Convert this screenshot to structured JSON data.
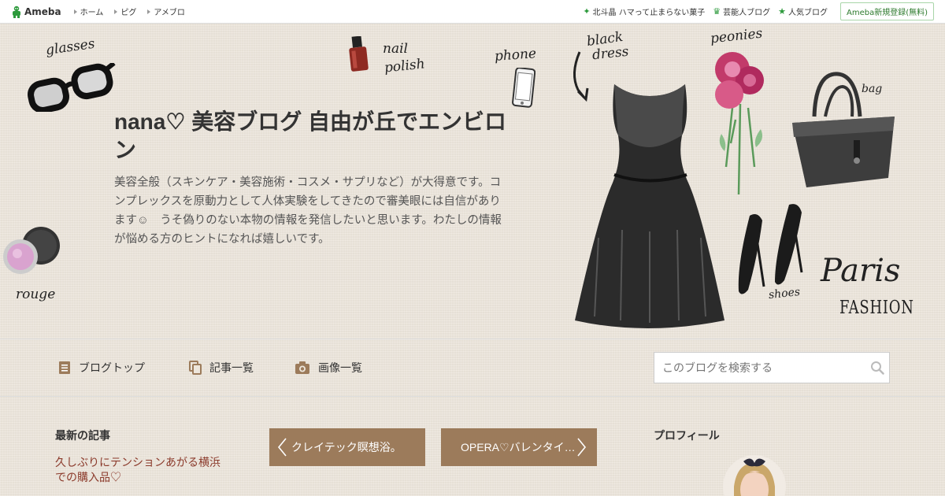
{
  "topbar": {
    "logo": "Ameba",
    "nav": [
      {
        "label": "ホーム"
      },
      {
        "label": "ピグ"
      },
      {
        "label": "アメブロ"
      }
    ],
    "right_links": [
      {
        "label": "北斗晶 ハマって止まらない菓子",
        "icon": "sparkle-icon"
      },
      {
        "label": "芸能人ブログ",
        "icon": "crown-icon"
      },
      {
        "label": "人気ブログ",
        "icon": "star-icon"
      }
    ],
    "signup": "Ameba新規登録(無料)"
  },
  "header": {
    "title": "nana♡ 美容ブログ 自由が丘でエンビロン",
    "description": "美容全般（スキンケア・美容施術・コスメ・サプリなど）が大得意です。コンプレックスを原動力として人体実験をしてきたので審美眼には自信があります☺　うそ偽りのない本物の情報を発信したいと思います。わたしの情報が悩める方のヒントになれば嬉しいです。",
    "illustration_labels": {
      "glasses": "glasses",
      "nail1": "nail",
      "nail2": "polish",
      "phone": "phone",
      "dress1": "black",
      "dress2": "dress",
      "peonies": "peonies",
      "bag": "bag",
      "shoes": "shoes",
      "rouge": "rouge",
      "paris": "Paris",
      "fashion": "FASHION"
    }
  },
  "nav": {
    "items": [
      {
        "label": "ブログトップ",
        "icon": "document-icon"
      },
      {
        "label": "記事一覧",
        "icon": "copy-icon"
      },
      {
        "label": "画像一覧",
        "icon": "camera-icon"
      }
    ],
    "search_placeholder": "このブログを検索する"
  },
  "content": {
    "latest_heading": "最新の記事",
    "latest_entry": "久しぶりにテンションあがる横浜での購入品♡",
    "prev_article": "クレイテック瞑想浴。",
    "next_article": "OPERA♡バレンタイ…",
    "profile_heading": "プロフィール"
  },
  "colors": {
    "accent_brown": "#9c7b5b",
    "link_red": "#8b3a2b",
    "ameba_green": "#2d9a3c",
    "background": "#ede6dc"
  }
}
